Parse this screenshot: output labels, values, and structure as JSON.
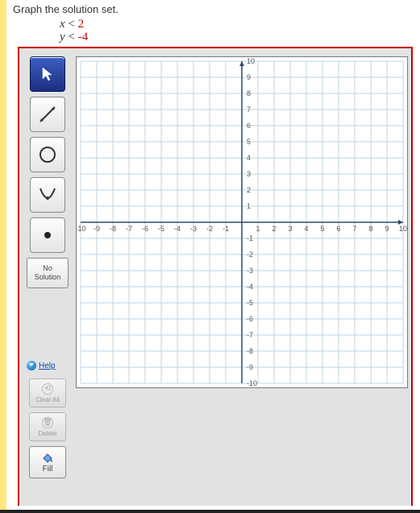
{
  "prompt": "Graph the solution set.",
  "ineq1": {
    "var": "x",
    "op": " < ",
    "val": "2"
  },
  "ineq2": {
    "var": "y",
    "op": " < ",
    "val": "-4"
  },
  "tools": {
    "pointer": "Pointer",
    "line": "Line",
    "circle": "Circle",
    "parabola": "Parabola",
    "point": "Point",
    "nosol_l1": "No",
    "nosol_l2": "Solution"
  },
  "help": "Help",
  "clearall": "Clear All",
  "delete": "Delete",
  "fill": "Fill",
  "chart_data": {
    "type": "scatter",
    "title": "",
    "xlabel": "",
    "ylabel": "",
    "xlim": [
      -10,
      10
    ],
    "ylim": [
      -10,
      10
    ],
    "xticks": [
      -10,
      -9,
      -8,
      -7,
      -6,
      -5,
      -4,
      -3,
      -2,
      -1,
      1,
      2,
      3,
      4,
      5,
      6,
      7,
      8,
      9,
      10
    ],
    "yticks": [
      -10,
      -9,
      -8,
      -7,
      -6,
      -5,
      -4,
      -3,
      -2,
      -1,
      1,
      2,
      3,
      4,
      5,
      6,
      7,
      8,
      9,
      10
    ],
    "grid": true,
    "series": []
  }
}
